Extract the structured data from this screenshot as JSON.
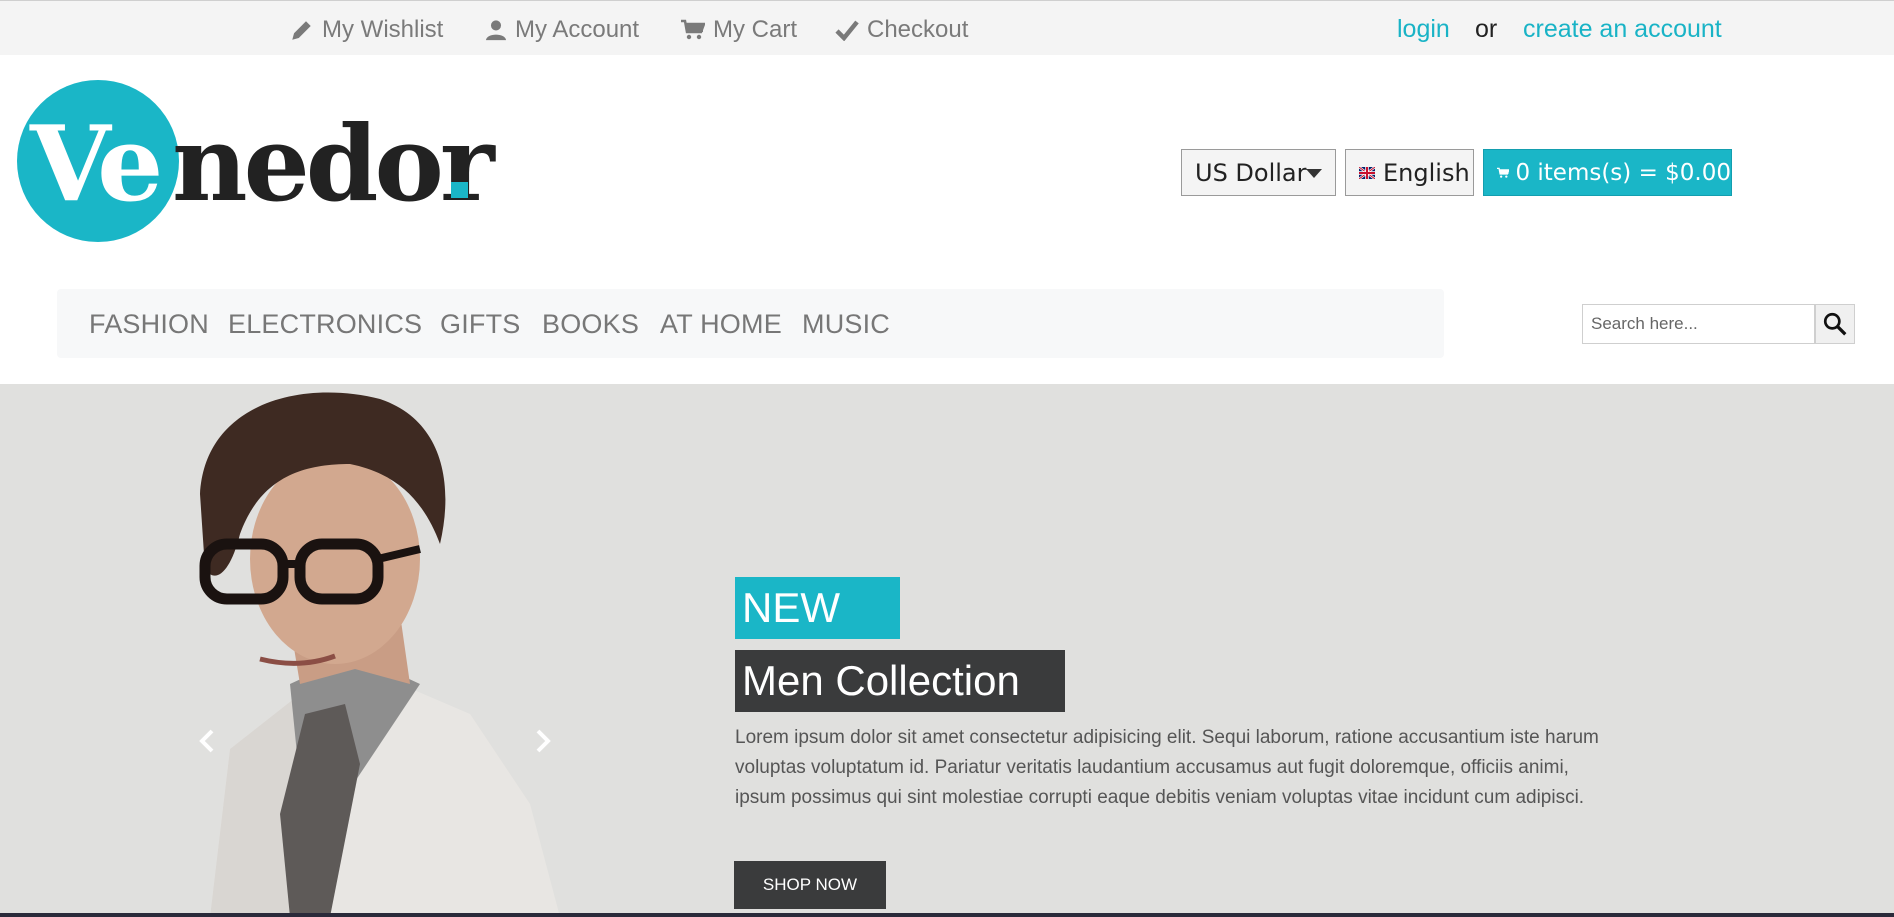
{
  "topbar": {
    "links": [
      {
        "label": "My Wishlist",
        "icon": "pencil-icon"
      },
      {
        "label": "My Account",
        "icon": "user-icon"
      },
      {
        "label": "My Cart",
        "icon": "cart-icon"
      },
      {
        "label": "Checkout",
        "icon": "check-icon"
      }
    ],
    "login_label": "login",
    "or_label": "or",
    "create_account_label": "create an account"
  },
  "brand": {
    "logo_part1": "Ve",
    "logo_part2": "nedor",
    "accent_color": "#1ab6c7"
  },
  "header": {
    "currency": "US Dollar",
    "language": "English",
    "cart_summary": "0 items(s) = $0.00"
  },
  "nav": {
    "items": [
      "FASHION",
      "ELECTRONICS",
      "GIFTS",
      "BOOKS",
      "AT HOME",
      "MUSIC"
    ]
  },
  "search": {
    "placeholder": "Search here..."
  },
  "hero": {
    "badge": "NEW",
    "title": "Men Collection",
    "description": "Lorem ipsum dolor sit amet consectetur adipisicing elit. Sequi laborum, ratione accusantium iste harum voluptas voluptatum id. Pariatur veritatis laudantium accusamus aut fugit doloremque, officiis animi, ipsum possimus qui sint molestiae corrupti eaque debitis veniam voluptas vitae incidunt cum adipisci.",
    "cta_label": "SHOP NOW"
  }
}
